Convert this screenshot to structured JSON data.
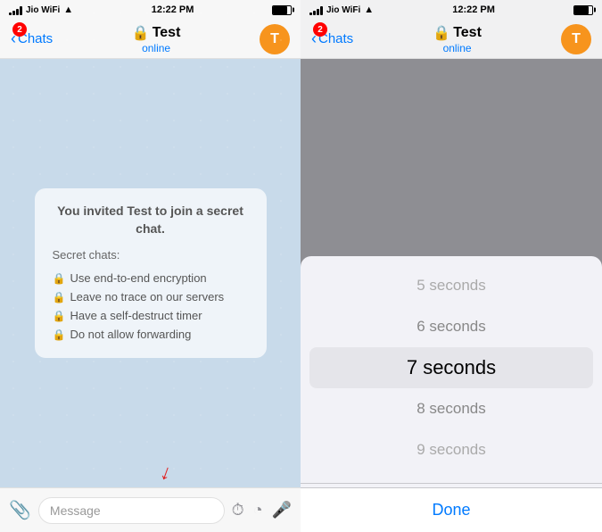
{
  "left": {
    "statusBar": {
      "carrier": "Jio WiFi",
      "time": "12:22 PM",
      "battery": "100"
    },
    "navBar": {
      "backLabel": "Chats",
      "badge": "2",
      "lockIcon": "🔒",
      "title": "Test",
      "status": "online",
      "avatarInitial": "T"
    },
    "secretChat": {
      "title": "You invited Test to join a secret chat.",
      "subtitle": "Secret chats:",
      "features": [
        "Use end-to-end encryption",
        "Leave no trace on our servers",
        "Have a self-destruct timer",
        "Do not allow forwarding"
      ]
    },
    "inputBar": {
      "placeholder": "Message"
    }
  },
  "right": {
    "statusBar": {
      "carrier": "Jio WiFi",
      "time": "12:22 PM"
    },
    "navBar": {
      "backLabel": "Chats",
      "badge": "2",
      "lockIcon": "🔒",
      "title": "Test",
      "status": "online",
      "avatarInitial": "T"
    },
    "picker": {
      "items": [
        {
          "label": "5 seconds",
          "selected": false
        },
        {
          "label": "6 seconds",
          "selected": false
        },
        {
          "label": "7 seconds",
          "selected": true
        },
        {
          "label": "8 seconds",
          "selected": false
        },
        {
          "label": "9 seconds",
          "selected": false
        }
      ],
      "doneLabel": "Done"
    }
  }
}
